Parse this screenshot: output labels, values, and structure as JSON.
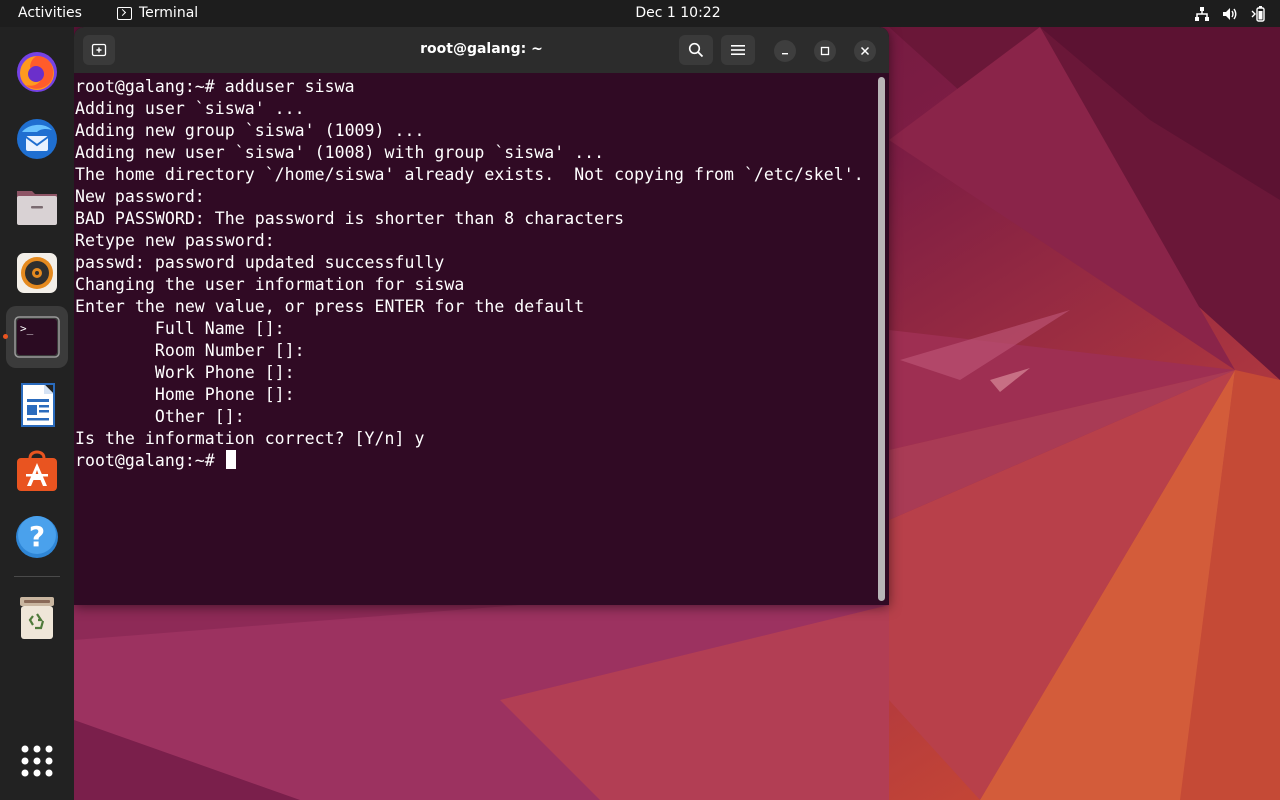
{
  "topbar": {
    "activities": "Activities",
    "app_name": "Terminal",
    "clock": "Dec 1  10:22",
    "tray_icons": [
      "network-icon",
      "volume-icon",
      "battery-icon"
    ]
  },
  "dock": {
    "items": [
      {
        "name": "firefox",
        "icon": "firefox-icon"
      },
      {
        "name": "thunderbird",
        "icon": "thunderbird-icon"
      },
      {
        "name": "files",
        "icon": "files-icon"
      },
      {
        "name": "rhythmbox",
        "icon": "rhythmbox-icon"
      },
      {
        "name": "terminal",
        "icon": "terminal-icon",
        "active": true
      },
      {
        "name": "libreoffice-writer",
        "icon": "writer-icon"
      },
      {
        "name": "software",
        "icon": "software-store-icon"
      },
      {
        "name": "help",
        "icon": "help-icon"
      },
      {
        "name": "trash",
        "icon": "trash-icon"
      },
      {
        "name": "show-apps",
        "icon": "app-grid-icon"
      }
    ],
    "terminal_glyph": ">_",
    "help_glyph": "?"
  },
  "window": {
    "title": "root@galang: ~",
    "lines": [
      "root@galang:~# adduser siswa",
      "Adding user `siswa' ...",
      "Adding new group `siswa' (1009) ...",
      "Adding new user `siswa' (1008) with group `siswa' ...",
      "The home directory `/home/siswa' already exists.  Not copying from `/etc/skel'.",
      "New password:",
      "BAD PASSWORD: The password is shorter than 8 characters",
      "Retype new password:",
      "passwd: password updated successfully",
      "Changing the user information for siswa",
      "Enter the new value, or press ENTER for the default",
      "        Full Name []:",
      "        Room Number []:",
      "        Work Phone []:",
      "        Home Phone []:",
      "        Other []:",
      "Is the information correct? [Y/n] y"
    ],
    "prompt": "root@galang:~# "
  },
  "colors": {
    "terminal_bg": "#300a24",
    "headerbar_bg": "#2c2c2c",
    "topbar_bg": "#1d1d1d",
    "dock_bg": "#222222",
    "accent": "#e95420"
  }
}
